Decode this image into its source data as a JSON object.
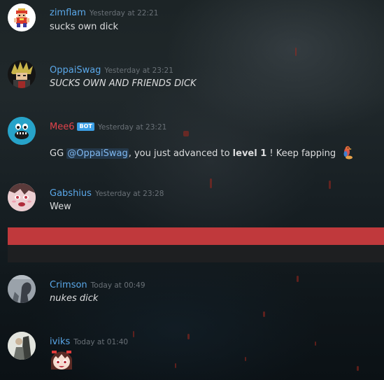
{
  "colors": {
    "username_default": "#5aa7e8",
    "username_bot": "#e0434b",
    "bot_tag": "#3b9fe6",
    "divider_red": "#c0393c"
  },
  "messages": [
    {
      "username": "zimflam",
      "timestamp": "Yesterday at 22:21",
      "text": "sucks own dick",
      "avatar_icon": "pixel-character-avatar"
    },
    {
      "username": "OppaiSwag",
      "timestamp": "Yesterday at 23:21",
      "text": "SUCKS OWN AND FRIENDS DICK",
      "avatar_icon": "spiky-hair-character-avatar"
    },
    {
      "username": "Mee6",
      "bot_tag": "BOT",
      "timestamp": "Yesterday at 23:21",
      "text_prefix": "GG ",
      "mention": "@OppaiSwag",
      "text_middle": ", you just advanced to ",
      "level": "level 1",
      "text_suffix": " ! Keep fapping",
      "emoji_icon": "parrot-emoji",
      "avatar_icon": "blue-mee6-avatar"
    },
    {
      "username": "Gabshius",
      "timestamp": "Yesterday at 23:28",
      "text": "Wew",
      "avatar_icon": "anime-girl-avatar"
    },
    {
      "username": "Crimson",
      "timestamp": "Today at 00:49",
      "text": "nukes dick",
      "avatar_icon": "grey-figure-avatar"
    },
    {
      "username": "iviks",
      "timestamp": "Today at 01:40",
      "emoji_icon": "anime-face-emoji",
      "avatar_icon": "light-figure-avatar"
    }
  ]
}
